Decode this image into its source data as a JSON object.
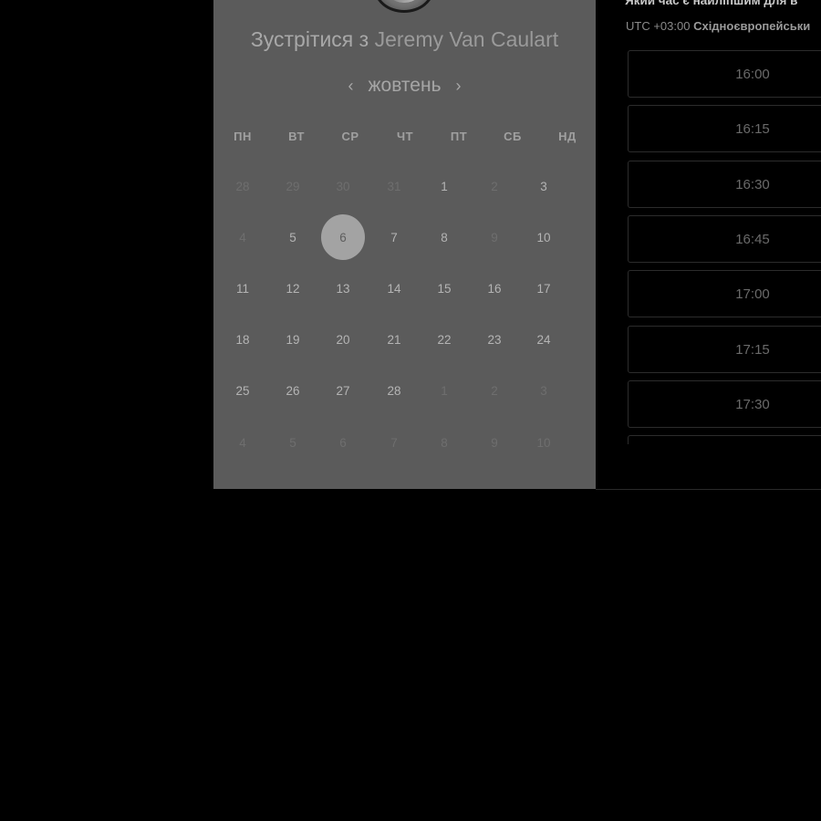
{
  "header": {
    "meet_prefix": "Зустрітися з",
    "meet_name": "Jeremy Van Caulart",
    "question": "Який час є найліпшим для в",
    "tz_offset": "UTC +03:00",
    "tz_name": "Східноєвропейськи"
  },
  "calendar": {
    "month": "жовтень",
    "prev_icon": "chevron-left-icon",
    "next_icon": "chevron-right-icon",
    "weekdays": [
      "ПН",
      "ВТ",
      "СР",
      "ЧТ",
      "ПТ",
      "СБ",
      "НД"
    ],
    "selected_day": "6",
    "weeks": [
      [
        {
          "t": "28",
          "m": true
        },
        {
          "t": "29",
          "m": true
        },
        {
          "t": "30",
          "m": true
        },
        {
          "t": "31",
          "m": true
        },
        {
          "t": "1",
          "m": false
        },
        {
          "t": "2",
          "m": true
        },
        {
          "t": "3",
          "m": false
        }
      ],
      [
        {
          "t": "4",
          "m": true
        },
        {
          "t": "5",
          "m": false
        },
        {
          "t": "6",
          "m": false,
          "s": true
        },
        {
          "t": "7",
          "m": false
        },
        {
          "t": "8",
          "m": false
        },
        {
          "t": "9",
          "m": true
        },
        {
          "t": "10",
          "m": false
        }
      ],
      [
        {
          "t": "11",
          "m": false
        },
        {
          "t": "12",
          "m": false
        },
        {
          "t": "13",
          "m": false
        },
        {
          "t": "14",
          "m": false
        },
        {
          "t": "15",
          "m": false
        },
        {
          "t": "16",
          "m": false
        },
        {
          "t": "17",
          "m": false
        }
      ],
      [
        {
          "t": "18",
          "m": false
        },
        {
          "t": "19",
          "m": false
        },
        {
          "t": "20",
          "m": false
        },
        {
          "t": "21",
          "m": false
        },
        {
          "t": "22",
          "m": false
        },
        {
          "t": "23",
          "m": false
        },
        {
          "t": "24",
          "m": false
        }
      ],
      [
        {
          "t": "25",
          "m": false
        },
        {
          "t": "26",
          "m": false
        },
        {
          "t": "27",
          "m": false
        },
        {
          "t": "28",
          "m": false
        },
        {
          "t": "1",
          "m": true
        },
        {
          "t": "2",
          "m": true
        },
        {
          "t": "3",
          "m": true
        }
      ],
      [
        {
          "t": "4",
          "m": true
        },
        {
          "t": "5",
          "m": true
        },
        {
          "t": "6",
          "m": true
        },
        {
          "t": "7",
          "m": true
        },
        {
          "t": "8",
          "m": true
        },
        {
          "t": "9",
          "m": true
        },
        {
          "t": "10",
          "m": true
        }
      ]
    ]
  },
  "time_slots": [
    "16:00",
    "16:15",
    "16:30",
    "16:45",
    "17:00",
    "17:15",
    "17:30",
    ""
  ],
  "colors": {
    "panel_bg": "#5b5b5b",
    "selected_bg": "#a3a3a3",
    "page_bg": "#000000"
  }
}
